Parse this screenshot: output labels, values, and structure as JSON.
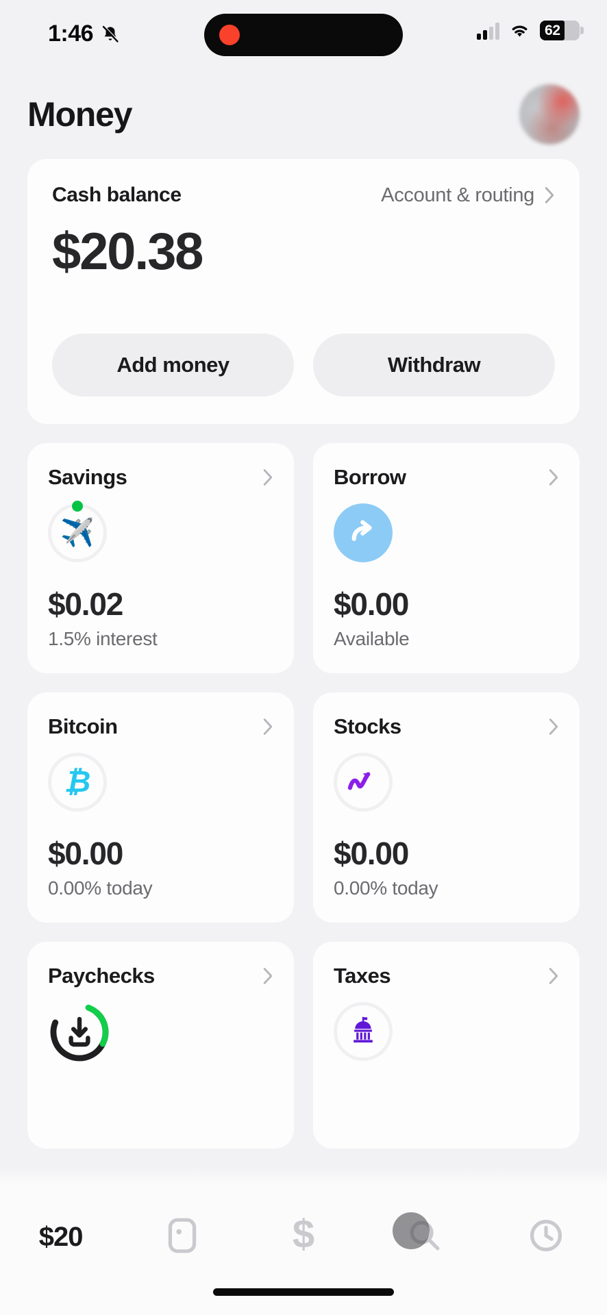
{
  "status_bar": {
    "time": "1:46",
    "mute_icon": "bell-slash-icon",
    "recording_indicator": "record-dot",
    "signal_bars_filled": 2,
    "signal_bars_total": 4,
    "wifi_icon": "wifi-icon",
    "battery_percent": "62",
    "battery_level": 62
  },
  "header": {
    "title": "Money",
    "avatar": "profile-avatar"
  },
  "balance_card": {
    "label": "Cash balance",
    "account_routing_label": "Account & routing",
    "chevron_icon": "chevron-right-icon",
    "amount": "$20.38",
    "add_money_label": "Add money",
    "withdraw_label": "Withdraw"
  },
  "tiles": [
    {
      "title": "Savings",
      "icon": "airplane-icon",
      "icon_glyph": "✈️",
      "icon_style": "ring-emoji",
      "has_green_dot": true,
      "amount": "$0.02",
      "subtitle": "1.5% interest",
      "chevron_icon": "chevron-right-icon"
    },
    {
      "title": "Borrow",
      "icon": "curved-arrow-icon",
      "icon_style": "blue-circle",
      "has_green_dot": false,
      "amount": "$0.00",
      "subtitle": "Available",
      "chevron_icon": "chevron-right-icon"
    },
    {
      "title": "Bitcoin",
      "icon": "bitcoin-icon",
      "icon_glyph": "₿",
      "icon_style": "ring-bitcoin",
      "has_green_dot": false,
      "amount": "$0.00",
      "subtitle": "0.00% today",
      "chevron_icon": "chevron-right-icon"
    },
    {
      "title": "Stocks",
      "icon": "chart-trending-up-icon",
      "icon_style": "ring-stocks",
      "has_green_dot": false,
      "amount": "$0.00",
      "subtitle": "0.00% today",
      "chevron_icon": "chevron-right-icon"
    },
    {
      "title": "Paychecks",
      "icon": "direct-deposit-icon",
      "icon_style": "progress-ring-download",
      "has_green_dot": false,
      "amount": "",
      "subtitle": "",
      "chevron_icon": "chevron-right-icon"
    },
    {
      "title": "Taxes",
      "icon": "government-building-icon",
      "icon_style": "ring-taxes",
      "has_green_dot": false,
      "amount": "",
      "subtitle": "",
      "chevron_icon": "chevron-right-icon"
    }
  ],
  "tab_bar": {
    "items": [
      {
        "label": "$20",
        "icon": "money-tab-label",
        "active": true
      },
      {
        "label": "",
        "icon": "card-icon",
        "active": false
      },
      {
        "label": "",
        "icon": "dollar-sign-icon",
        "active": false
      },
      {
        "label": "",
        "icon": "search-icon",
        "active": false
      },
      {
        "label": "",
        "icon": "clock-icon",
        "active": false
      }
    ],
    "cursor_over": "search-icon"
  },
  "colors": {
    "page_background": "#f2f2f4",
    "card_background": "#fdfdfd",
    "text_primary": "#1b1b1d",
    "text_secondary": "#6b6b70",
    "amount": "#27272a",
    "borrow_blue": "#8ccbf5",
    "bitcoin_cyan": "#24c8ef",
    "stocks_purple": "#8b20e8",
    "taxes_purple": "#6018d8",
    "savings_green": "#00c244",
    "paychecks_green": "#12ce4a",
    "record_red": "#f9412c"
  }
}
